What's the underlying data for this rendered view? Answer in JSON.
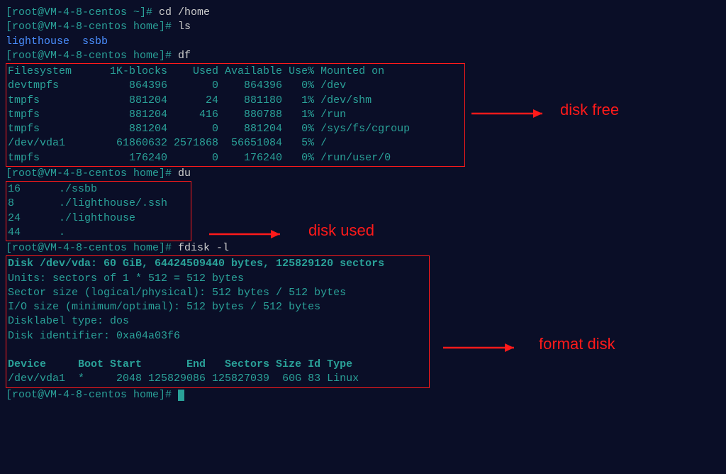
{
  "prompts": {
    "cd_prompt": "[root@VM-4-8-centos ~]# ",
    "cd_cmd": "cd /home",
    "ls_prompt": "[root@VM-4-8-centos home]# ",
    "ls_cmd": "ls",
    "ls_out_1": "lighthouse",
    "ls_out_2": "ssbb",
    "df_prompt": "[root@VM-4-8-centos home]# ",
    "df_cmd": "df",
    "du_prompt": "[root@VM-4-8-centos home]# ",
    "du_cmd": "du",
    "fdisk_prompt": "[root@VM-4-8-centos home]# ",
    "fdisk_cmd": "fdisk -l",
    "final_prompt": "[root@VM-4-8-centos home]# "
  },
  "df": {
    "header": "Filesystem      1K-blocks    Used Available Use% Mounted on",
    "rows": [
      "devtmpfs           864396       0    864396   0% /dev",
      "tmpfs              881204      24    881180   1% /dev/shm",
      "tmpfs              881204     416    880788   1% /run",
      "tmpfs              881204       0    881204   0% /sys/fs/cgroup",
      "/dev/vda1        61860632 2571868  56651084   5% /",
      "tmpfs              176240       0    176240   0% /run/user/0"
    ]
  },
  "du": {
    "rows": [
      "16      ./ssbb",
      "8       ./lighthouse/.ssh",
      "24      ./lighthouse",
      "44      ."
    ]
  },
  "fdisk": {
    "header": "Disk /dev/vda: 60 GiB, 64424509440 bytes, 125829120 sectors",
    "units": "Units: sectors of 1 * 512 = 512 bytes",
    "sector": "Sector size (logical/physical): 512 bytes / 512 bytes",
    "io": "I/O size (minimum/optimal): 512 bytes / 512 bytes",
    "label": "Disklabel type: dos",
    "ident": "Disk identifier: 0xa04a03f6",
    "part_header": "Device     Boot Start       End   Sectors Size Id Type",
    "part_row": "/dev/vda1  *     2048 125829086 125827039  60G 83 Linux"
  },
  "annotations": {
    "disk_free": "disk free",
    "disk_used": "disk used",
    "format_disk": "format disk"
  }
}
